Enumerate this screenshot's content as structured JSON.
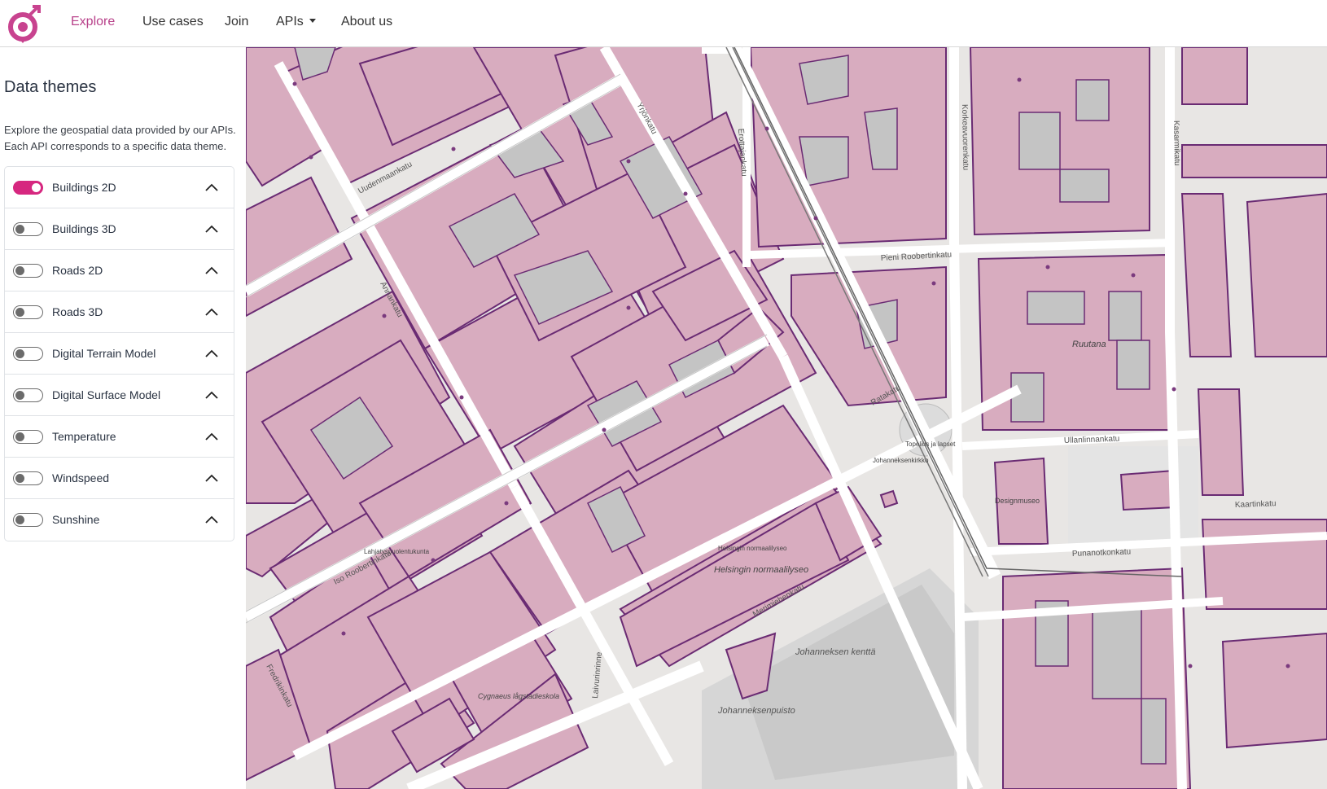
{
  "nav": {
    "items": [
      {
        "label": "Explore",
        "active": true
      },
      {
        "label": "Use cases"
      },
      {
        "label": "Join"
      },
      {
        "label": "APIs",
        "dropdown": true
      },
      {
        "label": "About us"
      }
    ]
  },
  "sidebar": {
    "title": "Data themes",
    "description": "Explore the geospatial data provided by our APIs. Each API corresponds to a specific data theme.",
    "themes": [
      {
        "label": "Buildings 2D",
        "enabled": true
      },
      {
        "label": "Buildings 3D",
        "enabled": false
      },
      {
        "label": "Roads 2D",
        "enabled": false
      },
      {
        "label": "Roads 3D",
        "enabled": false
      },
      {
        "label": "Digital Terrain Model",
        "enabled": false
      },
      {
        "label": "Digital Surface Model",
        "enabled": false
      },
      {
        "label": "Temperature",
        "enabled": false
      },
      {
        "label": "Windspeed",
        "enabled": false
      },
      {
        "label": "Sunshine",
        "enabled": false
      }
    ]
  },
  "map": {
    "streets": [
      "Uudenmaankatu",
      "Iso Roobertinkatu",
      "Annankatu",
      "Yrjönkatu",
      "Erottajankatu",
      "Korkeavuorenkatu",
      "Kasarmikatu",
      "Pieni Roobertinkatu",
      "Ratakatu",
      "Ullanlinnankatu",
      "Kaartinkatu",
      "Punanotkonkatu",
      "Merimiehenkatu",
      "Fredrikinkatu",
      "Laivurinrinne"
    ],
    "places": [
      {
        "label": "Ruutana"
      },
      {
        "label": "Helsingin normaalilyseo"
      },
      {
        "label": "Johanneksen kenttä"
      },
      {
        "label": "Johanneksenpuisto"
      },
      {
        "label": "Designmuseo"
      },
      {
        "label": "Cygnaeus lågstadieskola"
      },
      {
        "label": "Topelius ja lapset"
      },
      {
        "label": "Johanneksenkirkko"
      },
      {
        "label": "Lahjatyspuolentukunta"
      },
      {
        "label": "Helsingin normaalilyseo",
        "secondary": true
      }
    ],
    "colors": {
      "building_fill": "#d8acbf",
      "building_stroke": "#6a2b73",
      "road": "#ffffff",
      "ground": "#e8e6e4",
      "park": "#d4d4d4"
    }
  },
  "colors": {
    "accent": "#b8418a",
    "toggle_on": "#d6277f"
  }
}
